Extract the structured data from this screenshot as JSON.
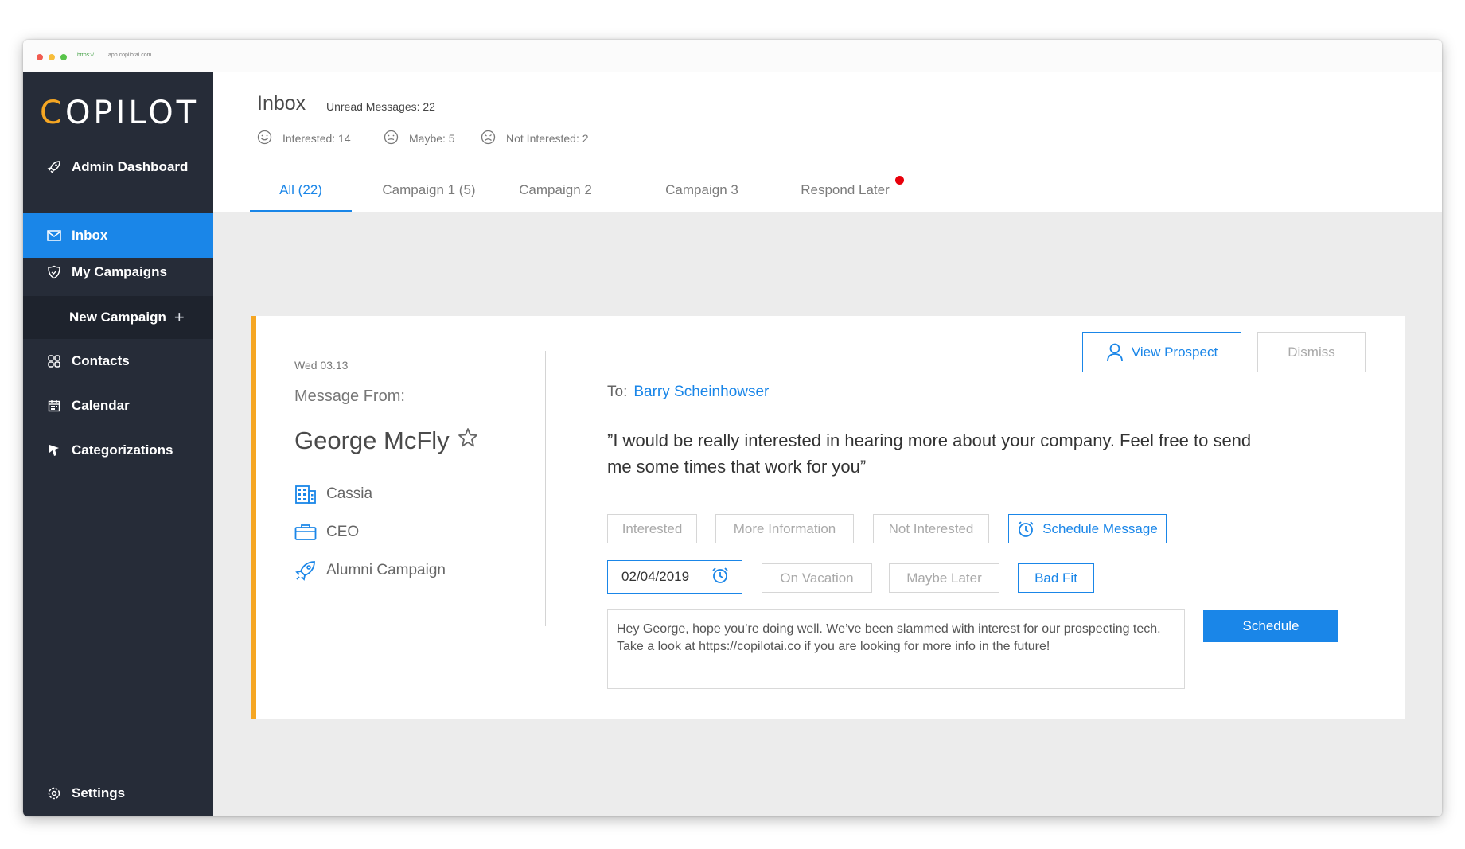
{
  "browser": {
    "url_protocol": "https://",
    "url_host": "app.copilotai.com"
  },
  "sidebar": {
    "logo_first": "C",
    "logo_rest": "OPILOT",
    "items": [
      {
        "label": "Admin Dashboard",
        "icon": "rocket-icon"
      },
      {
        "label": "Inbox",
        "icon": "envelope-icon",
        "active": true
      },
      {
        "label": "My Campaigns",
        "icon": "shield-icon"
      },
      {
        "label": "Contacts",
        "icon": "contacts-icon"
      },
      {
        "label": "Calendar",
        "icon": "calendar-icon"
      },
      {
        "label": "Categorizations",
        "icon": "pin-icon"
      }
    ],
    "new_campaign": "New Campaign",
    "settings": "Settings"
  },
  "header": {
    "title": "Inbox",
    "unread": "Unread Messages: 22",
    "stats": {
      "interested": "Interested: 14",
      "maybe": "Maybe: 5",
      "not_interested": "Not Interested: 2"
    },
    "tabs": [
      {
        "label": "All (22)",
        "active": true
      },
      {
        "label": "Campaign 1 (5)"
      },
      {
        "label": "Campaign 2"
      },
      {
        "label": "Campaign 3"
      },
      {
        "label": "Respond Later",
        "notification": true
      }
    ]
  },
  "message": {
    "date": "Wed 03.13",
    "from_label": "Message From:",
    "sender_name": "George McFly",
    "company": "Cassia",
    "title": "CEO",
    "campaign": "Alumni Campaign",
    "to_label": "To:",
    "to_name": "Barry Scheinhowser",
    "quote": "”I would be really interested in hearing more about your company. Feel free to send me some times that work for you”",
    "actions": {
      "view_prospect": "View Prospect",
      "dismiss": "Dismiss"
    },
    "categories": {
      "interested": "Interested",
      "more_information": "More Information",
      "not_interested": "Not Interested",
      "schedule_message": "Schedule Message",
      "on_vacation": "On Vacation",
      "maybe_later": "Maybe Later",
      "bad_fit": "Bad Fit"
    },
    "schedule_date": "02/04/2019",
    "reply_text": "Hey George, hope you’re doing well. We’ve been slammed with interest for our prospecting tech. Take a look at https://copilotai.co if you are looking for more info in the future!",
    "schedule_button": "Schedule"
  },
  "colors": {
    "sidebar_bg": "#262c38",
    "accent_blue": "#1a86e8",
    "accent_orange": "#f5a623",
    "notification_red": "#e8000b"
  }
}
